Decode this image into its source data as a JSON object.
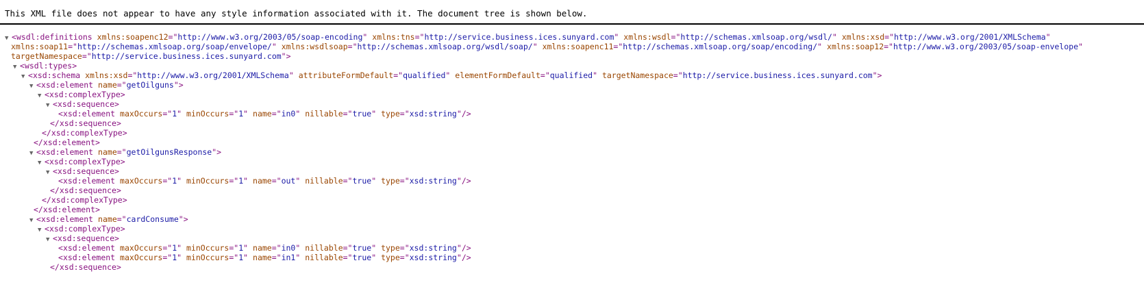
{
  "header": {
    "message": "This XML file does not appear to have any style information associated with it. The document tree is shown below."
  },
  "lines": [
    {
      "indent": 0,
      "toggle": "▼",
      "open": true,
      "tag": "wsdl:definitions",
      "attrs": [
        {
          "n": "xmlns:soapenc12",
          "v": "http://www.w3.org/2003/05/soap-encoding"
        },
        {
          "n": "xmlns:tns",
          "v": "http://service.business.ices.sunyard.com"
        },
        {
          "n": "xmlns:wsdl",
          "v": "http://schemas.xmlsoap.org/wsdl/"
        },
        {
          "n": "xmlns:xsd",
          "v": "http://www.w3.org/2001/XMLSchema"
        }
      ],
      "close": ""
    },
    {
      "indent": 1,
      "toggle": "",
      "open": false,
      "tag": "",
      "attrs": [
        {
          "n": "xmlns:soap11",
          "v": "http://schemas.xmlsoap.org/soap/envelope/"
        },
        {
          "n": "xmlns:wsdlsoap",
          "v": "http://schemas.xmlsoap.org/wsdl/soap/"
        },
        {
          "n": "xmlns:soapenc11",
          "v": "http://schemas.xmlsoap.org/soap/encoding/"
        },
        {
          "n": "xmlns:soap12",
          "v": "http://www.w3.org/2003/05/soap-envelope"
        }
      ],
      "close": "",
      "cont": true
    },
    {
      "indent": 1,
      "toggle": "",
      "open": false,
      "tag": "",
      "attrs": [
        {
          "n": "targetNamespace",
          "v": "http://service.business.ices.sunyard.com"
        }
      ],
      "close": ">",
      "cont": true
    },
    {
      "indent": 2,
      "toggle": "▼",
      "open": true,
      "tag": "wsdl:types",
      "attrs": [],
      "close": ">"
    },
    {
      "indent": 4,
      "toggle": "▼",
      "open": true,
      "tag": "xsd:schema",
      "attrs": [
        {
          "n": "xmlns:xsd",
          "v": "http://www.w3.org/2001/XMLSchema"
        },
        {
          "n": "attributeFormDefault",
          "v": "qualified"
        },
        {
          "n": "elementFormDefault",
          "v": "qualified"
        },
        {
          "n": "targetNamespace",
          "v": "http://service.business.ices.sunyard.com"
        }
      ],
      "close": ">"
    },
    {
      "indent": 6,
      "toggle": "▼",
      "open": true,
      "tag": "xsd:element",
      "attrs": [
        {
          "n": "name",
          "v": "getOilguns"
        }
      ],
      "close": ">"
    },
    {
      "indent": 8,
      "toggle": "▼",
      "open": true,
      "tag": "xsd:complexType",
      "attrs": [],
      "close": ">"
    },
    {
      "indent": 10,
      "toggle": "▼",
      "open": true,
      "tag": "xsd:sequence",
      "attrs": [],
      "close": ">"
    },
    {
      "indent": 13,
      "toggle": "",
      "open": true,
      "tag": "xsd:element",
      "attrs": [
        {
          "n": "maxOccurs",
          "v": "1"
        },
        {
          "n": "minOccurs",
          "v": "1"
        },
        {
          "n": "name",
          "v": "in0"
        },
        {
          "n": "nillable",
          "v": "true"
        },
        {
          "n": "type",
          "v": "xsd:string"
        }
      ],
      "close": "/>"
    },
    {
      "indent": 11,
      "toggle": "",
      "open": false,
      "tag": "xsd:sequence",
      "attrs": [],
      "close": ">"
    },
    {
      "indent": 9,
      "toggle": "",
      "open": false,
      "tag": "xsd:complexType",
      "attrs": [],
      "close": ">"
    },
    {
      "indent": 7,
      "toggle": "",
      "open": false,
      "tag": "xsd:element",
      "attrs": [],
      "close": ">"
    },
    {
      "indent": 6,
      "toggle": "▼",
      "open": true,
      "tag": "xsd:element",
      "attrs": [
        {
          "n": "name",
          "v": "getOilgunsResponse"
        }
      ],
      "close": ">"
    },
    {
      "indent": 8,
      "toggle": "▼",
      "open": true,
      "tag": "xsd:complexType",
      "attrs": [],
      "close": ">"
    },
    {
      "indent": 10,
      "toggle": "▼",
      "open": true,
      "tag": "xsd:sequence",
      "attrs": [],
      "close": ">"
    },
    {
      "indent": 13,
      "toggle": "",
      "open": true,
      "tag": "xsd:element",
      "attrs": [
        {
          "n": "maxOccurs",
          "v": "1"
        },
        {
          "n": "minOccurs",
          "v": "1"
        },
        {
          "n": "name",
          "v": "out"
        },
        {
          "n": "nillable",
          "v": "true"
        },
        {
          "n": "type",
          "v": "xsd:string"
        }
      ],
      "close": "/>"
    },
    {
      "indent": 11,
      "toggle": "",
      "open": false,
      "tag": "xsd:sequence",
      "attrs": [],
      "close": ">"
    },
    {
      "indent": 9,
      "toggle": "",
      "open": false,
      "tag": "xsd:complexType",
      "attrs": [],
      "close": ">"
    },
    {
      "indent": 7,
      "toggle": "",
      "open": false,
      "tag": "xsd:element",
      "attrs": [],
      "close": ">"
    },
    {
      "indent": 6,
      "toggle": "▼",
      "open": true,
      "tag": "xsd:element",
      "attrs": [
        {
          "n": "name",
          "v": "cardConsume"
        }
      ],
      "close": ">"
    },
    {
      "indent": 8,
      "toggle": "▼",
      "open": true,
      "tag": "xsd:complexType",
      "attrs": [],
      "close": ">"
    },
    {
      "indent": 10,
      "toggle": "▼",
      "open": true,
      "tag": "xsd:sequence",
      "attrs": [],
      "close": ">"
    },
    {
      "indent": 13,
      "toggle": "",
      "open": true,
      "tag": "xsd:element",
      "attrs": [
        {
          "n": "maxOccurs",
          "v": "1"
        },
        {
          "n": "minOccurs",
          "v": "1"
        },
        {
          "n": "name",
          "v": "in0"
        },
        {
          "n": "nillable",
          "v": "true"
        },
        {
          "n": "type",
          "v": "xsd:string"
        }
      ],
      "close": "/>"
    },
    {
      "indent": 13,
      "toggle": "",
      "open": true,
      "tag": "xsd:element",
      "attrs": [
        {
          "n": "maxOccurs",
          "v": "1"
        },
        {
          "n": "minOccurs",
          "v": "1"
        },
        {
          "n": "name",
          "v": "in1"
        },
        {
          "n": "nillable",
          "v": "true"
        },
        {
          "n": "type",
          "v": "xsd:string"
        }
      ],
      "close": "/>"
    },
    {
      "indent": 11,
      "toggle": "",
      "open": false,
      "tag": "xsd:sequence",
      "attrs": [],
      "close": ">"
    }
  ],
  "colors": {
    "tag": "#881280",
    "attr_name": "#994500",
    "attr_value": "#1a1aa6"
  }
}
